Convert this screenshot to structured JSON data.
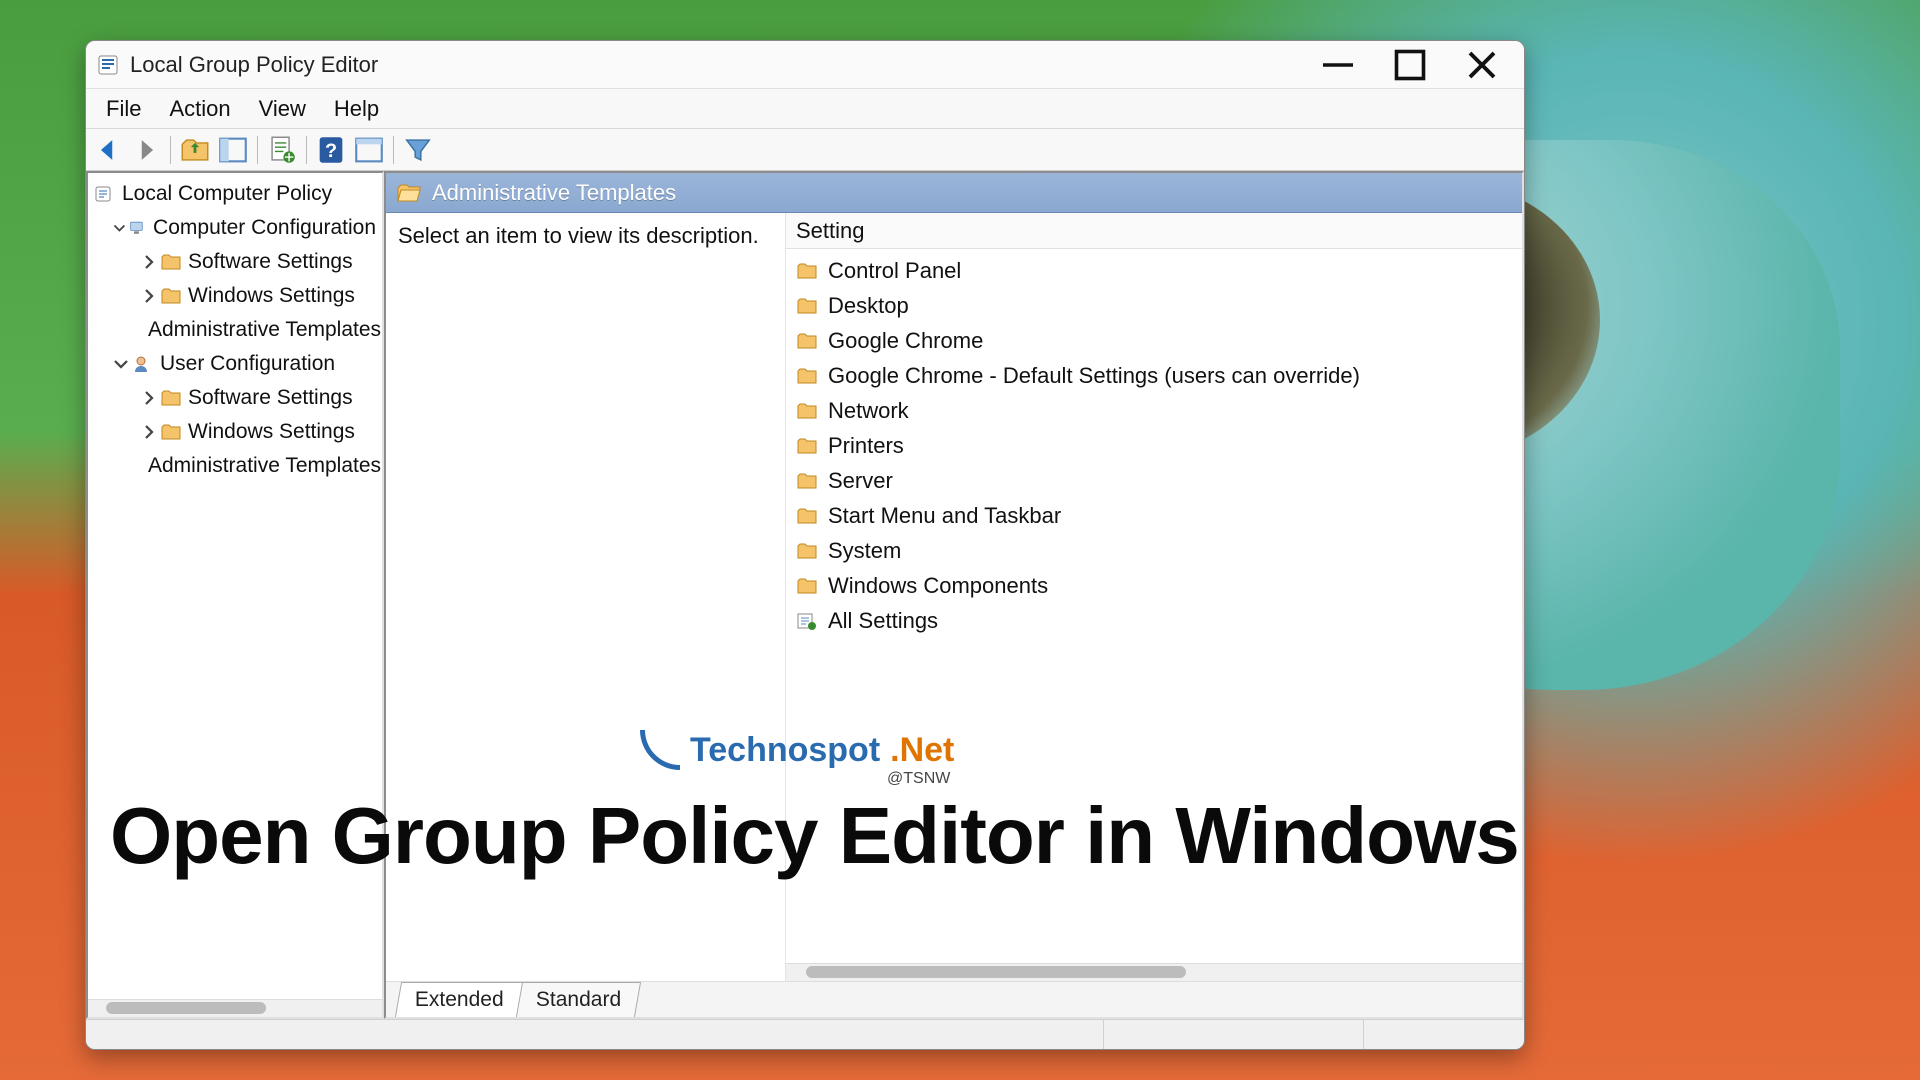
{
  "window": {
    "title": "Local Group Policy Editor"
  },
  "menu": {
    "file": "File",
    "action": "Action",
    "view": "View",
    "help": "Help"
  },
  "tree": {
    "root": "Local Computer Policy",
    "computer_config": "Computer Configuration",
    "cc_software": "Software Settings",
    "cc_windows": "Windows Settings",
    "cc_admin": "Administrative Templates",
    "user_config": "User Configuration",
    "uc_software": "Software Settings",
    "uc_windows": "Windows Settings",
    "uc_admin": "Administrative Templates"
  },
  "header": {
    "title": "Administrative Templates"
  },
  "description": {
    "placeholder": "Select an item to view its description."
  },
  "list": {
    "column": "Setting",
    "items": [
      "Control Panel",
      "Desktop",
      "Google Chrome",
      "Google Chrome - Default Settings (users can override)",
      "Network",
      "Printers",
      "Server",
      "Start Menu and Taskbar",
      "System",
      "Windows Components"
    ],
    "all_settings": "All Settings"
  },
  "tabs": {
    "extended": "Extended",
    "standard": "Standard"
  },
  "overlay": {
    "logo_part1": "Technospot",
    "logo_part2": ".Net",
    "logo_sub": "@TSNW",
    "headline": "Open Group Policy Editor in Windows"
  }
}
